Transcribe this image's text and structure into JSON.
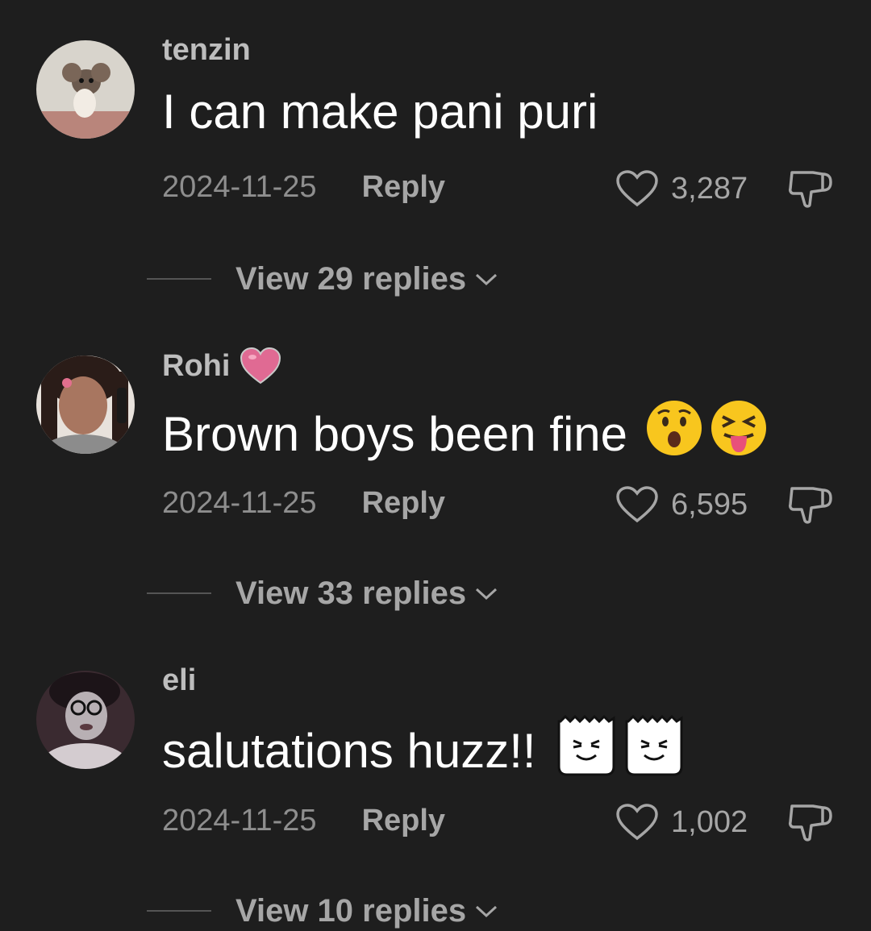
{
  "colors": {
    "background": "#1e1e1e",
    "text_primary": "#ffffff",
    "text_secondary": "#a6a6a6",
    "text_muted": "#8e8e8e"
  },
  "comments": [
    {
      "username": "tenzin",
      "username_badge": null,
      "text": "I can make pani puri",
      "text_emojis": [],
      "date": "2024-11-25",
      "reply_label": "Reply",
      "likes": "3,287",
      "view_replies": "View 29 replies",
      "avatar_icon": "cartoon-mouse-avatar"
    },
    {
      "username": "Rohi",
      "username_badge": "pink-heart-icon",
      "text": "Brown boys been fine",
      "text_emojis": [
        "hushed-face-emoji",
        "squinting-tongue-emoji"
      ],
      "date": "2024-11-25",
      "reply_label": "Reply",
      "likes": "6,595",
      "view_replies": "View 33 replies",
      "avatar_icon": "selfie-avatar"
    },
    {
      "username": "eli",
      "username_badge": null,
      "text": "salutations huzz!!",
      "text_emojis": [
        "smirk-sticker-emoji",
        "smirk-sticker-emoji"
      ],
      "date": "2024-11-25",
      "reply_label": "Reply",
      "likes": "1,002",
      "view_replies": "View 10 replies",
      "avatar_icon": "grayscale-selfie-avatar"
    }
  ]
}
